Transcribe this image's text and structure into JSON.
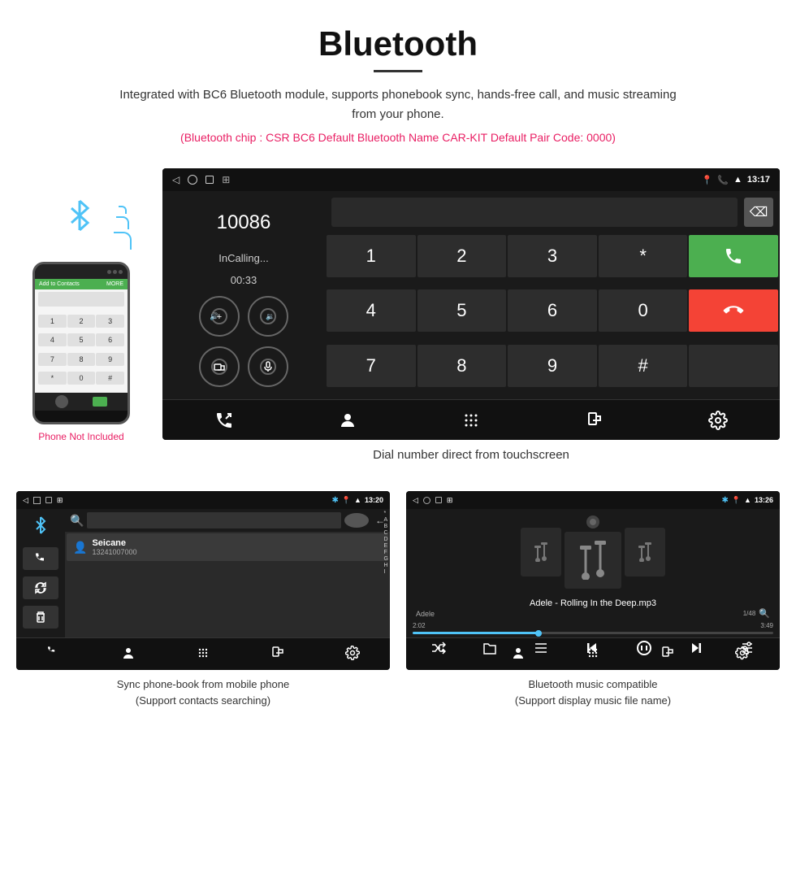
{
  "header": {
    "title": "Bluetooth",
    "description": "Integrated with BC6 Bluetooth module, supports phonebook sync, hands-free call, and music streaming from your phone.",
    "info": "(Bluetooth chip : CSR BC6    Default Bluetooth Name CAR-KIT    Default Pair Code: 0000)"
  },
  "main_screen": {
    "status_bar": {
      "time": "13:17",
      "nav_icons": [
        "◁",
        "○",
        "□",
        "⊞"
      ]
    },
    "dial": {
      "number": "10086",
      "status": "InCalling...",
      "timer": "00:33"
    },
    "keypad": [
      "1",
      "2",
      "3",
      "*",
      "4",
      "5",
      "6",
      "0",
      "7",
      "8",
      "9",
      "#"
    ],
    "caption": "Dial number direct from touchscreen"
  },
  "phone_section": {
    "not_included_label": "Phone Not Included"
  },
  "phonebook_screen": {
    "status_bar_time": "13:20",
    "contact_name": "Seicane",
    "contact_number": "13241007000",
    "alpha_list": [
      "*",
      "A",
      "B",
      "C",
      "D",
      "E",
      "F",
      "G",
      "H",
      "I"
    ],
    "caption_line1": "Sync phone-book from mobile phone",
    "caption_line2": "(Support contacts searching)"
  },
  "music_screen": {
    "status_bar_time": "13:26",
    "song_title": "Adele - Rolling In the Deep.mp3",
    "artist": "Adele",
    "track_info": "1/48",
    "time_current": "2:02",
    "time_total": "3:49",
    "caption_line1": "Bluetooth music compatible",
    "caption_line2": "(Support display music file name)"
  },
  "icons": {
    "bluetooth": "✱",
    "back_arrow": "◁",
    "circle": "○",
    "square": "□",
    "volume_up": "🔊",
    "volume_down": "🔉",
    "transfer": "⇄",
    "mic": "🎤",
    "phone_call": "📞",
    "person": "👤",
    "keypad_icon": "⠿",
    "transfer_phone": "⇆",
    "settings": "⚙",
    "shuffle": "⇌",
    "prev": "⏮",
    "play_pause": "⏸",
    "next": "⏭",
    "equalizer": "⊞",
    "search": "🔍",
    "folder": "📁",
    "list": "≡",
    "trash": "🗑"
  },
  "colors": {
    "green": "#4caf50",
    "red": "#f44336",
    "blue": "#4fc3f7",
    "pink": "#e91e63",
    "dark_bg": "#1a1a1a",
    "status_bar": "#111111"
  }
}
